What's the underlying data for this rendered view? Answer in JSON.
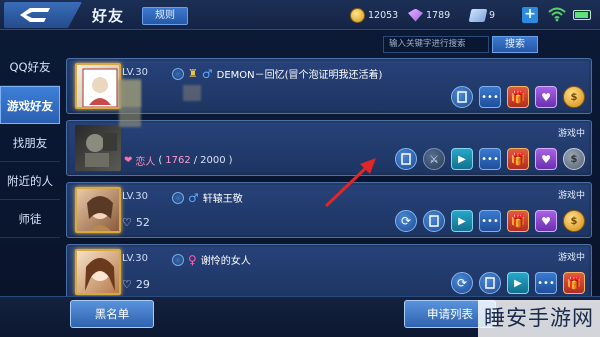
{
  "header": {
    "title": "好友",
    "rules_label": "规则",
    "gold": "12053",
    "diamonds": "1789",
    "vouchers": "9"
  },
  "sidebar": {
    "items": [
      {
        "label": "QQ好友",
        "active": false
      },
      {
        "label": "游戏好友",
        "active": true
      },
      {
        "label": "找朋友",
        "active": false
      },
      {
        "label": "附近的人",
        "active": false
      },
      {
        "label": "师徒",
        "active": false
      }
    ]
  },
  "search": {
    "placeholder": "输入关键字进行搜索",
    "button_label": "搜索"
  },
  "friends": [
    {
      "level": "LV.30",
      "name": "DEMON－回忆(冒个泡证明我还活着)",
      "gender": "male",
      "status": "",
      "likes": ""
    },
    {
      "level": "",
      "name": "",
      "gender": "",
      "status": "游戏中",
      "relation": "恋人",
      "relation_value": "1762",
      "relation_max": "2000"
    },
    {
      "level": "LV.30",
      "name": "轩辕王敬",
      "gender": "male",
      "status": "游戏中",
      "likes": "52"
    },
    {
      "level": "LV.30",
      "name": "谢怜的女人",
      "gender": "female",
      "status": "游戏中",
      "likes": "29"
    }
  ],
  "footer": {
    "blacklist_label": "黑名单",
    "apply_label": "申请列表"
  },
  "watermark": "睡安手游网",
  "colors": {
    "accent": "#2f63ae",
    "panel": "#1d3562",
    "arrow": "#e02626"
  }
}
